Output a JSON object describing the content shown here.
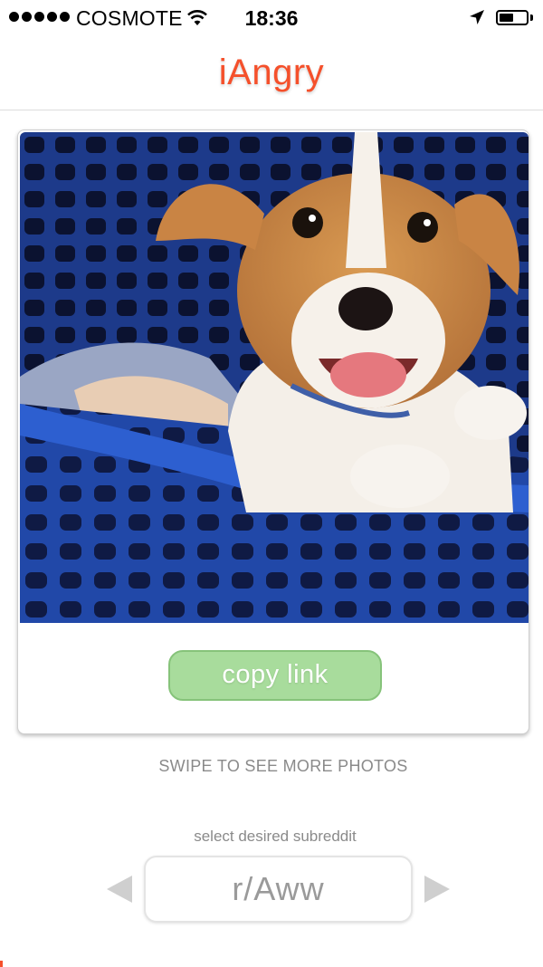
{
  "status_bar": {
    "carrier": "COSMOTE",
    "time": "18:36",
    "signal_bars": 5,
    "battery_level": 0.55
  },
  "nav": {
    "title": "iAngry"
  },
  "card": {
    "photo_subject": "puppy-in-shopping-cart",
    "copy_button_label": "copy link"
  },
  "swipe_hint": "SWIPE TO SEE MORE PHOTOS",
  "subreddit": {
    "label": "select desired subreddit",
    "selected": "r/Aww"
  },
  "colors": {
    "accent": "#f5502b",
    "button_green": "#a8dc9c",
    "muted_text": "#8a8a8a"
  },
  "icons": [
    "wifi-icon",
    "location-arrow-icon",
    "battery-icon",
    "arrow-left-icon",
    "arrow-right-icon"
  ]
}
